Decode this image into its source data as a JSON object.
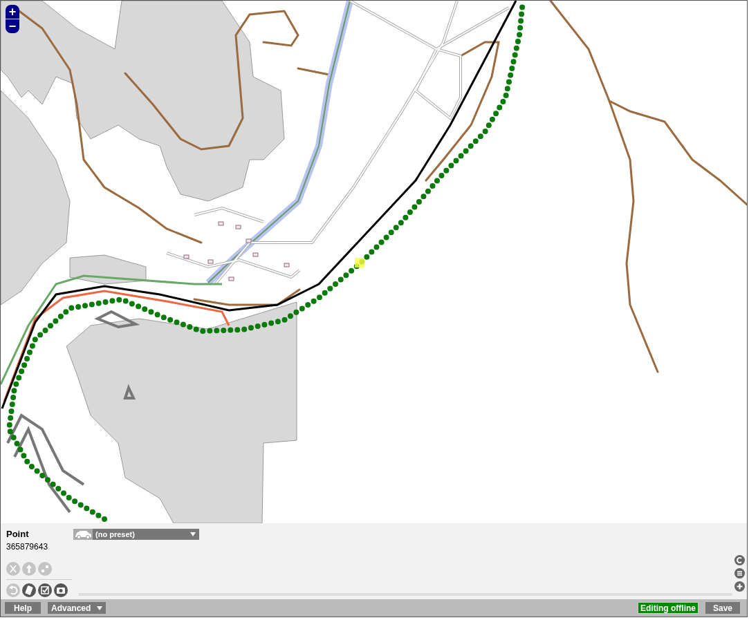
{
  "zoom_controls": {
    "zoom_in": "+",
    "zoom_out": "−"
  },
  "inspector": {
    "feature_type": "Point",
    "feature_id": "365879643",
    "preset": "(no preset)"
  },
  "tools": [
    {
      "kind": "scissors",
      "disabled": true
    },
    {
      "kind": "arrow",
      "disabled": true
    },
    {
      "kind": "squares",
      "disabled": true
    },
    {
      "kind": "undo",
      "disabled": true
    },
    {
      "kind": "eraser",
      "disabled": false
    },
    {
      "kind": "checkbox",
      "disabled": false
    },
    {
      "kind": "camera",
      "disabled": false
    }
  ],
  "bottom_bar": {
    "help": "Help",
    "advanced": "Advanced",
    "status": "Editing offline",
    "save": "Save"
  }
}
